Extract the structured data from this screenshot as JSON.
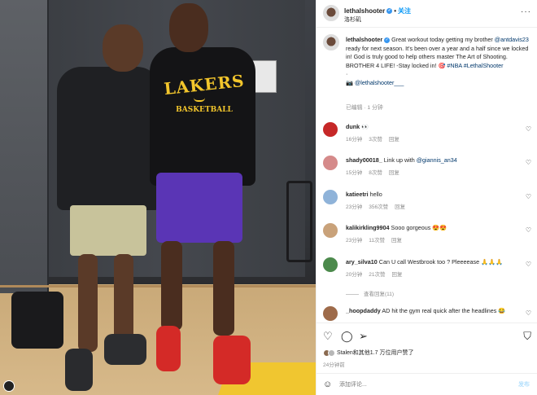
{
  "post": {
    "author": "lethalshooter",
    "follow_label": "关注",
    "subtitle": "洛杉矶",
    "more_label": "···"
  },
  "caption": {
    "author": "lethalshooter",
    "text_a": "Great workout today getting my brother",
    "mention_ad": "@antdavis23",
    "text_b": "ready for next season. It's been over a year and a half since we locked in! God is truly good to help others master The Art of Shooting. BROTHER 4 LIFE! -Stay locked in!",
    "hashtag_nba": "#NBA",
    "hashtag_lethal": "#LethalShooter",
    "dot": "·",
    "camera_mention": "@lethalshooter___",
    "edited": "已编辑 · 1 分钟"
  },
  "comments": [
    {
      "user": "dunk",
      "text": "👀",
      "time": "16分钟",
      "likes": "3次赞",
      "reply": "回复",
      "avatar_color": "#c62828"
    },
    {
      "user": "shady00018_",
      "text": "Link up with",
      "mention": "@giannis_an34",
      "time": "15分钟",
      "likes": "8次赞",
      "reply": "回复",
      "avatar_color": "#d58a8a"
    },
    {
      "user": "katieetri",
      "text": "hello",
      "time": "23分钟",
      "likes": "356次赞",
      "reply": "回复",
      "avatar_color": "#8fb3d9"
    },
    {
      "user": "kalikirkling9904",
      "text": "Sooo gorgeous 😍😍",
      "time": "23分钟",
      "likes": "11次赞",
      "reply": "回复",
      "avatar_color": "#c9a27a"
    },
    {
      "user": "ary_silva10",
      "text": "Can U call Westbrook too ? Pleeeease 🙏🙏🙏",
      "time": "20分钟",
      "likes": "21次赞",
      "reply": "回复",
      "avatar_color": "#4c8a4c"
    },
    {
      "user": "_hoopdaddy",
      "text": "AD hit the gym real quick after the headlines 😂",
      "time": "",
      "likes": "",
      "reply": "",
      "avatar_color": "#9e6b4a"
    }
  ],
  "view_replies": "查看回复(11)",
  "actions": {
    "like_icon": "heart-outline-icon",
    "comment_icon": "comment-icon",
    "share_icon": "send-icon",
    "save_icon": "bookmark-icon"
  },
  "likes_text": "Stalen和其他1.7 万位用户赞了",
  "date": "24分钟前",
  "add_comment": {
    "placeholder": "添加评论...",
    "post_label": "发布"
  },
  "lakers_text": "LAKERS",
  "basketball_text": "BASKETBALL"
}
